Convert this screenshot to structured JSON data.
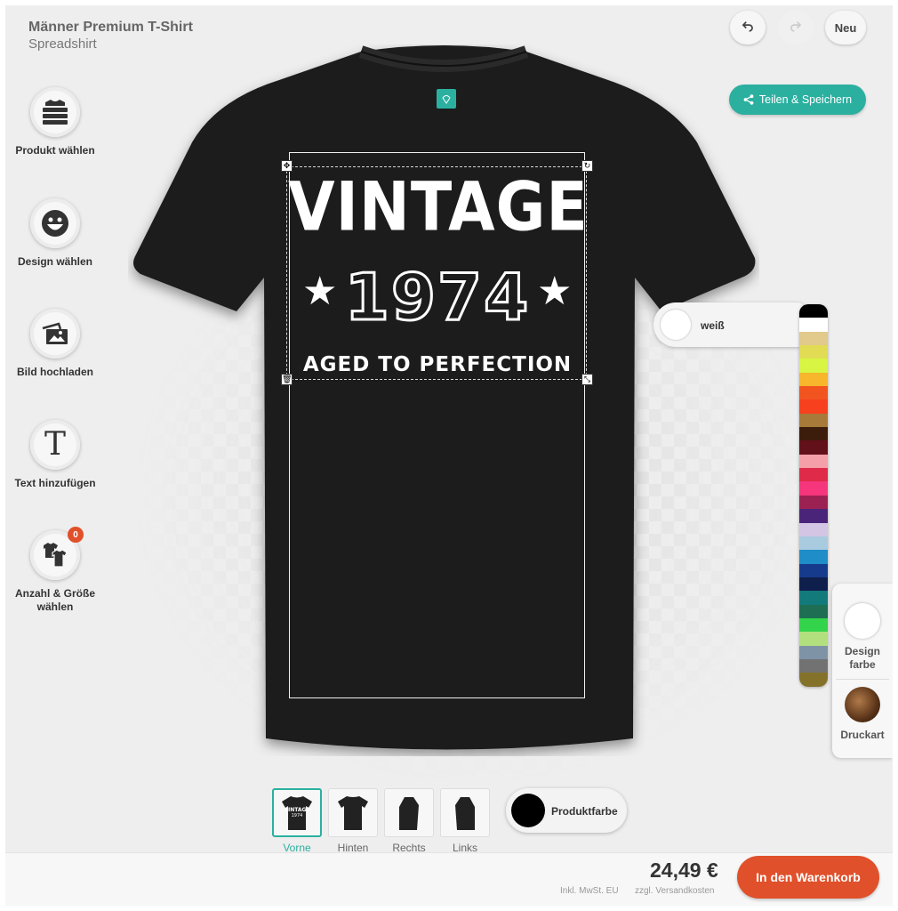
{
  "header": {
    "product_title": "Männer Premium T-Shirt",
    "shop_name": "Spreadshirt",
    "undo_icon": "undo-icon",
    "redo_icon": "redo-icon",
    "new_label": "Neu",
    "share_label": "Teilen & Speichern"
  },
  "tools": [
    {
      "label": "Produkt wählen",
      "icon": "shirt-stack-icon"
    },
    {
      "label": "Design wählen",
      "icon": "smiley-icon"
    },
    {
      "label": "Bild hochladen",
      "icon": "image-upload-icon"
    },
    {
      "label": "Text hinzufügen",
      "icon": "text-icon",
      "glyph": "T"
    },
    {
      "label": "Anzahl & Größe wählen",
      "icon": "shirts-icon",
      "badge": "0"
    }
  ],
  "design": {
    "line1": "VINTAGE",
    "line2": "1974",
    "line3": "AGED TO PERFECTION",
    "star": "★",
    "text_color": "#ffffff"
  },
  "shirt": {
    "color": "#1f1f1f",
    "tag_color": "#2bb0a0"
  },
  "design_color": {
    "selected_name": "weiß",
    "selected_hex": "#ffffff",
    "palette": [
      "#000000",
      "#ffffff",
      "#e2c98c",
      "#e2dc55",
      "#d7f542",
      "#f7b62c",
      "#f25420",
      "#f7401e",
      "#a77a3a",
      "#3c1c0b",
      "#62101a",
      "#f5a0a8",
      "#e02a4a",
      "#f5357c",
      "#9c2153",
      "#4a2478",
      "#d5c5e5",
      "#a8cbe0",
      "#1e8dc8",
      "#173b8c",
      "#0f1f4c",
      "#127a7a",
      "#1d6e52",
      "#33d44c",
      "#b2e07e",
      "#7f93a7",
      "#727272",
      "#84722b"
    ]
  },
  "side_panel": {
    "design_color_label": "Design farbe",
    "print_type_label": "Druckart"
  },
  "views": [
    {
      "label": "Vorne",
      "active": true
    },
    {
      "label": "Hinten",
      "active": false
    },
    {
      "label": "Rechts",
      "active": false
    },
    {
      "label": "Links",
      "active": false
    }
  ],
  "product_color": {
    "label": "Produktfarbe",
    "hex": "#000000"
  },
  "footer": {
    "price": "24,49 €",
    "tax_note": "Inkl. MwSt. EU",
    "shipping_note": "zzgl. Versandkosten",
    "cart_label": "In den Warenkorb"
  }
}
